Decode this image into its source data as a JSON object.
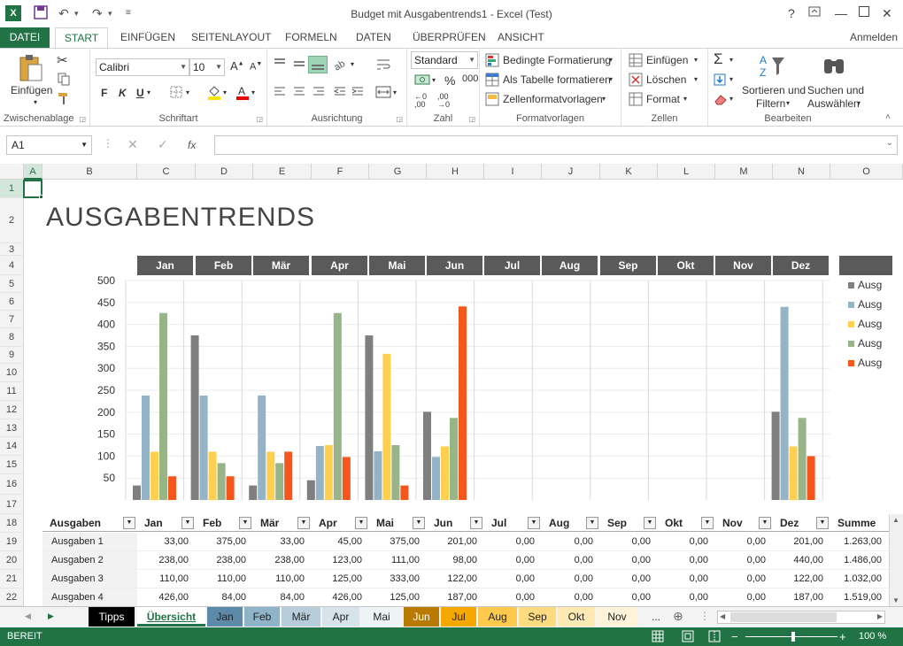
{
  "window": {
    "title": "Budget mit Ausgabentrends1 - Excel (Test)",
    "app_icon": "X",
    "help": "?"
  },
  "ribbon_tabs": [
    {
      "label": "DATEI",
      "x": 0
    },
    {
      "label": "START"
    },
    {
      "label": "EINFÜGEN"
    },
    {
      "label": "SEITENLAYOUT"
    },
    {
      "label": "FORMELN"
    },
    {
      "label": "DATEN"
    },
    {
      "label": "ÜBERPRÜFEN"
    },
    {
      "label": "ANSICHT"
    }
  ],
  "signin": "Anmelden",
  "ribbon": {
    "clipboard": {
      "paste": "Einfügen",
      "label": "Zwischenablage"
    },
    "font": {
      "name": "Calibri",
      "size": "10",
      "bold": "F",
      "italic": "K",
      "underline": "U",
      "label": "Schriftart"
    },
    "alignment": {
      "label": "Ausrichtung"
    },
    "number": {
      "format": "Standard",
      "percent": "%",
      "label": "Zahl"
    },
    "styles": {
      "conditional": "Bedingte Formatierung",
      "as_table": "Als Tabelle formatieren",
      "cell_styles": "Zellenformatvorlagen",
      "label": "Formatvorlagen"
    },
    "cells": {
      "insert": "Einfügen",
      "delete": "Löschen",
      "format": "Format",
      "label": "Zellen"
    },
    "editing": {
      "sort1": "Sortieren und",
      "sort2": "Filtern",
      "find1": "Suchen und",
      "find2": "Auswählen",
      "label": "Bearbeiten"
    }
  },
  "formula_bar": {
    "name_box": "A1",
    "fx": "fx"
  },
  "columns": [
    "A",
    "B",
    "C",
    "D",
    "E",
    "F",
    "G",
    "H",
    "I",
    "J",
    "K",
    "L",
    "M",
    "N",
    "O"
  ],
  "rows": [
    "1",
    "2",
    "3",
    "4",
    "5",
    "6",
    "7",
    "8",
    "9",
    "10",
    "11",
    "12",
    "13",
    "14",
    "15",
    "16",
    "17",
    "18",
    "19",
    "20",
    "21",
    "22"
  ],
  "sheet_title": "AUSGABENTRENDS",
  "months": [
    "Jan",
    "Feb",
    "Mär",
    "Apr",
    "Mai",
    "Jun",
    "Jul",
    "Aug",
    "Sep",
    "Okt",
    "Nov",
    "Dez"
  ],
  "legend_text": "Ausg",
  "colors": {
    "excel_green": "#217346",
    "s1": "#7f7f7f",
    "s2": "#95b3c7",
    "s3": "#ffd050",
    "s4": "#98b58a",
    "s5": "#f4561b"
  },
  "chart_data": {
    "type": "bar",
    "categories": [
      "Jan",
      "Feb",
      "Mär",
      "Apr",
      "Mai",
      "Jun",
      "Jul",
      "Aug",
      "Sep",
      "Okt",
      "Nov",
      "Dez"
    ],
    "ylim": [
      0,
      500
    ],
    "yticks": [
      "500",
      "450",
      "400",
      "350",
      "300",
      "250",
      "200",
      "150",
      "100",
      "50"
    ],
    "series": [
      {
        "values": [
          33,
          375,
          33,
          45,
          375,
          201,
          0,
          0,
          0,
          0,
          0,
          201
        ]
      },
      {
        "values": [
          238,
          238,
          238,
          123,
          111,
          98,
          0,
          0,
          0,
          0,
          0,
          440
        ]
      },
      {
        "values": [
          110,
          110,
          110,
          125,
          333,
          122,
          0,
          0,
          0,
          0,
          0,
          122
        ]
      },
      {
        "values": [
          426,
          84,
          84,
          426,
          125,
          187,
          0,
          0,
          0,
          0,
          0,
          187
        ]
      },
      {
        "values": [
          54,
          54,
          110,
          98,
          33,
          441,
          0,
          0,
          0,
          0,
          0,
          100
        ]
      }
    ]
  },
  "table": {
    "headers": [
      "Ausgaben",
      "Jan",
      "Feb",
      "Mär",
      "Apr",
      "Mai",
      "Jun",
      "Jul",
      "Aug",
      "Sep",
      "Okt",
      "Nov",
      "Dez",
      "Summe"
    ],
    "rows": [
      [
        "Ausgaben 1",
        "33,00",
        "375,00",
        "33,00",
        "45,00",
        "375,00",
        "201,00",
        "0,00",
        "0,00",
        "0,00",
        "0,00",
        "0,00",
        "201,00",
        "1.263,00"
      ],
      [
        "Ausgaben 2",
        "238,00",
        "238,00",
        "238,00",
        "123,00",
        "111,00",
        "98,00",
        "0,00",
        "0,00",
        "0,00",
        "0,00",
        "0,00",
        "440,00",
        "1.486,00"
      ],
      [
        "Ausgaben 3",
        "110,00",
        "110,00",
        "110,00",
        "125,00",
        "333,00",
        "122,00",
        "0,00",
        "0,00",
        "0,00",
        "0,00",
        "0,00",
        "122,00",
        "1.032,00"
      ],
      [
        "Ausgaben 4",
        "426,00",
        "84,00",
        "84,00",
        "426,00",
        "125,00",
        "187,00",
        "0,00",
        "0,00",
        "0,00",
        "0,00",
        "0,00",
        "187,00",
        "1.519,00"
      ]
    ]
  },
  "sheet_tabs": [
    {
      "label": "Tipps",
      "bg": "#000000",
      "fg": "#ffffff"
    },
    {
      "label": "Übersicht",
      "bg": "#ffffff",
      "fg": "#217346"
    },
    {
      "label": "Jan",
      "bg": "#5d8aa8",
      "fg": "#222222"
    },
    {
      "label": "Feb",
      "bg": "#8fb3c9",
      "fg": "#222222"
    },
    {
      "label": "Mär",
      "bg": "#b7cdd9",
      "fg": "#222222"
    },
    {
      "label": "Apr",
      "bg": "#d7e3ea",
      "fg": "#222222"
    },
    {
      "label": "Mai",
      "bg": "#eef3f6",
      "fg": "#222222"
    },
    {
      "label": "Jun",
      "bg": "#b87a00",
      "fg": "#ffffff"
    },
    {
      "label": "Jul",
      "bg": "#f5a800",
      "fg": "#222222"
    },
    {
      "label": "Aug",
      "bg": "#ffc94d",
      "fg": "#222222"
    },
    {
      "label": "Sep",
      "bg": "#ffdb80",
      "fg": "#222222"
    },
    {
      "label": "Okt",
      "bg": "#ffe9b3",
      "fg": "#222222"
    },
    {
      "label": "Nov",
      "bg": "#fff4d9",
      "fg": "#222222"
    }
  ],
  "sheet_more": "...",
  "status": {
    "ready": "BEREIT",
    "zoom": "100 %"
  }
}
